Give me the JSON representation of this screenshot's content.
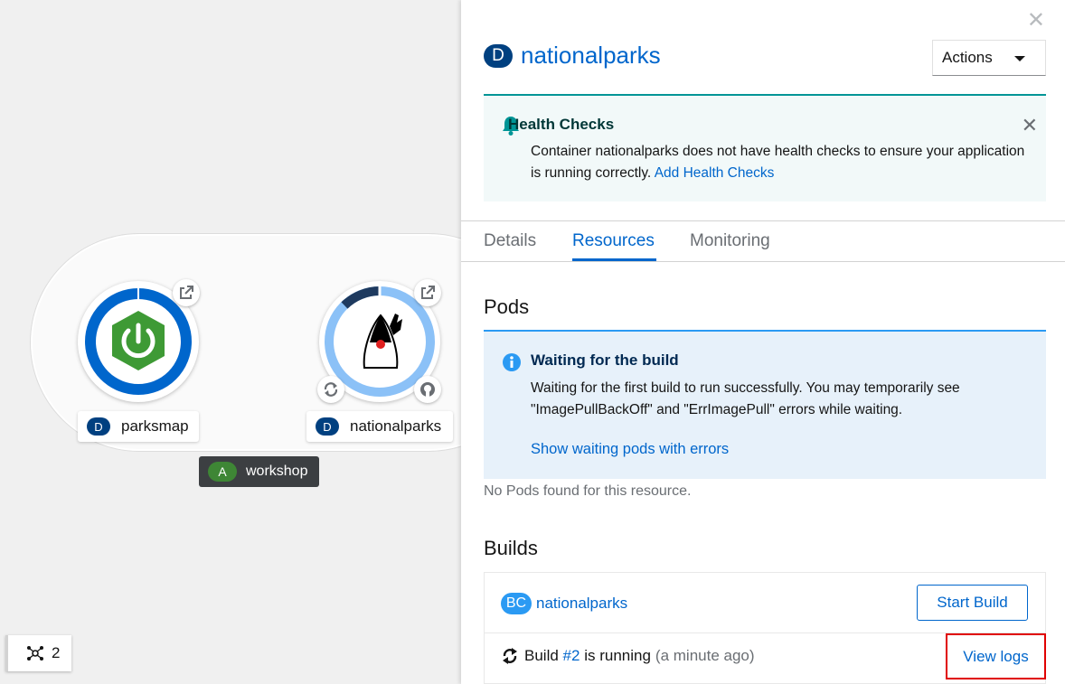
{
  "topology": {
    "group": {
      "badge": "A",
      "name": "workshop"
    },
    "nodes": [
      {
        "badge": "D",
        "name": "parksmap"
      },
      {
        "badge": "D",
        "name": "nationalparks"
      }
    ],
    "count": "2"
  },
  "panel": {
    "resource_badge": "D",
    "resource_name": "nationalparks",
    "actions_label": "Actions",
    "health_alert": {
      "title": "Health Checks",
      "body": "Container nationalparks does not have health checks to ensure your application is running correctly.",
      "link": "Add Health Checks"
    },
    "tabs": [
      {
        "label": "Details"
      },
      {
        "label": "Resources"
      },
      {
        "label": "Monitoring"
      }
    ],
    "pods": {
      "title": "Pods",
      "alert_title": "Waiting for the build",
      "alert_body": "Waiting for the first build to run successfully. You may temporarily see \"ImagePullBackOff\" and \"ErrImagePull\" errors while waiting.",
      "alert_link": "Show waiting pods with errors",
      "empty": "No Pods found for this resource."
    },
    "builds": {
      "title": "Builds",
      "bc_badge": "BC",
      "bc_name": "nationalparks",
      "start_build": "Start Build",
      "build_prefix": "Build",
      "build_number": "#2",
      "build_status": "is running",
      "build_time": "(a minute ago)",
      "view_logs": "View logs"
    }
  }
}
